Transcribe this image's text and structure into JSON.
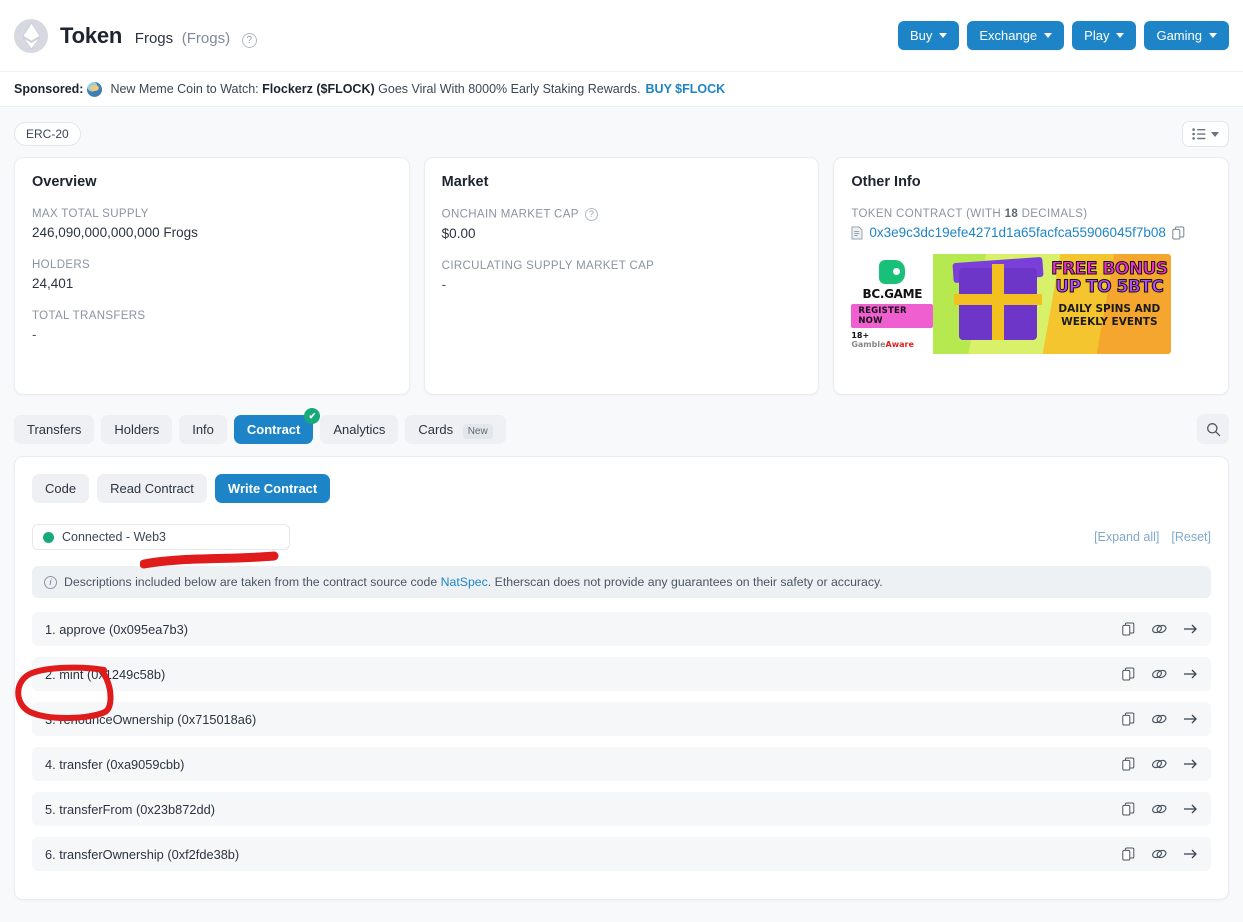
{
  "header": {
    "logo_icon": "ethereum-diamond-icon",
    "title": "Token",
    "token_name": "Frogs",
    "token_symbol": "(Frogs)",
    "help_icon": "question-circle-icon",
    "buttons": [
      {
        "label": "Buy",
        "icon": "chevron-down-icon"
      },
      {
        "label": "Exchange",
        "icon": "chevron-down-icon"
      },
      {
        "label": "Play",
        "icon": "chevron-down-icon"
      },
      {
        "label": "Gaming",
        "icon": "chevron-down-icon"
      }
    ]
  },
  "sponsored": {
    "label": "Sponsored:",
    "icon": "flockerz-avatar-icon",
    "text_before": "New Meme Coin to Watch:",
    "bold_text": "Flockerz ($FLOCK)",
    "text_after": "Goes Viral With 8000% Early Staking Rewards.",
    "cta": "BUY $FLOCK"
  },
  "badge_row": {
    "standard": "ERC-20",
    "list_icon": "list-view-icon",
    "list_caret": "chevron-down-icon"
  },
  "overview": {
    "title": "Overview",
    "rows": [
      {
        "label": "MAX TOTAL SUPPLY",
        "value": "246,090,000,000,000 Frogs"
      },
      {
        "label": "HOLDERS",
        "value": "24,401"
      },
      {
        "label": "TOTAL TRANSFERS",
        "value": "-"
      }
    ]
  },
  "market": {
    "title": "Market",
    "rows": [
      {
        "label": "ONCHAIN MARKET CAP",
        "has_help": true,
        "value": "$0.00"
      },
      {
        "label": "CIRCULATING SUPPLY MARKET CAP",
        "has_help": false,
        "value": "-"
      }
    ]
  },
  "other_info": {
    "title": "Other Info",
    "contract_label_pre": "TOKEN CONTRACT (WITH ",
    "contract_decimals": "18",
    "contract_label_post": " DECIMALS)",
    "doc_icon": "document-icon",
    "contract_address": "0x3e9c3dc19efe4271d1a65facfca55906045f7b08",
    "copy_icon": "copy-icon",
    "ad": {
      "brand": "BC.GAME",
      "register": "REGISTER NOW",
      "age": "18+",
      "gamble": "Gamble",
      "aware": "Aware",
      "headline1": "FREE BONUS",
      "headline2": "UP TO 5BTC",
      "sub1": "DAILY SPINS AND",
      "sub2": "WEEKLY EVENTS"
    }
  },
  "tabs": [
    {
      "label": "Transfers",
      "active": false,
      "badge": ""
    },
    {
      "label": "Holders",
      "active": false,
      "badge": ""
    },
    {
      "label": "Info",
      "active": false,
      "badge": ""
    },
    {
      "label": "Contract",
      "active": true,
      "badge": "",
      "verified_icon": "check-circle-icon"
    },
    {
      "label": "Analytics",
      "active": false,
      "badge": ""
    },
    {
      "label": "Cards",
      "active": false,
      "badge": "New"
    }
  ],
  "tabs_search_icon": "search-icon",
  "contract_panel": {
    "subtabs": [
      {
        "label": "Code",
        "active": false
      },
      {
        "label": "Read Contract",
        "active": false
      },
      {
        "label": "Write Contract",
        "active": true
      }
    ],
    "connection": {
      "status_icon": "green-dot-icon",
      "text": "Connected - Web3"
    },
    "expand_all": "[Expand all]",
    "reset": "[Reset]",
    "notice": {
      "icon": "info-circle-icon",
      "text_before": "Descriptions included below are taken from the contract source code",
      "link": "NatSpec",
      "text_after": ". Etherscan does not provide any guarantees on their safety or accuracy."
    },
    "row_icons": {
      "copy": "copy-icon",
      "link": "link-icon",
      "open": "arrow-right-icon"
    },
    "functions": [
      {
        "label": "1. approve (0x095ea7b3)"
      },
      {
        "label": "2. mint (0x1249c58b)"
      },
      {
        "label": "3. renounceOwnership (0x715018a6)"
      },
      {
        "label": "4. transfer (0xa9059cbb)"
      },
      {
        "label": "5. transferFrom (0x23b872dd)"
      },
      {
        "label": "6. transferOwnership (0xf2fde38b)"
      }
    ]
  },
  "annotations": {
    "redaction_stroke": "red-strikethrough-over-wallet-address",
    "circle_highlight": "red-circle-around-mint-function",
    "color": "#e01b1b"
  }
}
